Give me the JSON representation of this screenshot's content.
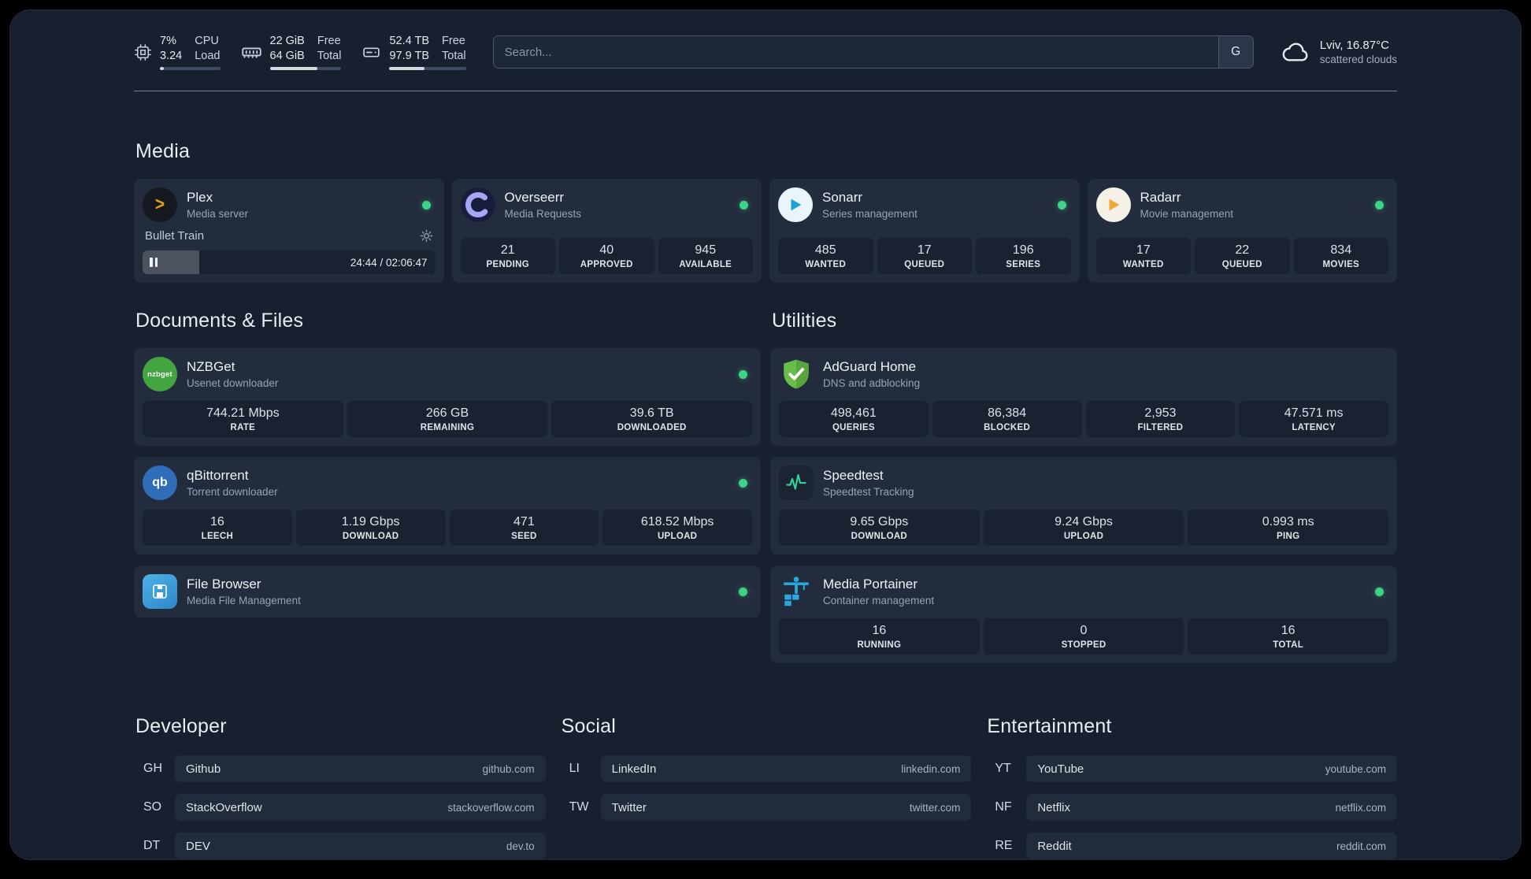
{
  "topbar": {
    "cpu": {
      "value1": "7%",
      "value2": "3.24",
      "label1": "CPU",
      "label2": "Load",
      "percent": 7
    },
    "memory": {
      "value1": "22 GiB",
      "value2": "64 GiB",
      "label1": "Free",
      "label2": "Total",
      "percent": 66
    },
    "disk": {
      "value1": "52.4 TB",
      "value2": "97.9 TB",
      "label1": "Free",
      "label2": "Total",
      "percent": 46
    },
    "search": {
      "placeholder": "Search...",
      "provider_button": "G"
    },
    "weather": {
      "location": "Lviv, 16.87°C",
      "condition": "scattered clouds"
    }
  },
  "media": {
    "title": "Media",
    "plex": {
      "name": "Plex",
      "subtitle": "Media server",
      "now_playing": "Bullet Train",
      "time": "24:44 / 02:06:47",
      "progress_percent": 19.5,
      "icon_glyph": ">"
    },
    "overseerr": {
      "name": "Overseerr",
      "subtitle": "Media Requests",
      "stats": [
        {
          "value": "21",
          "label": "PENDING"
        },
        {
          "value": "40",
          "label": "APPROVED"
        },
        {
          "value": "945",
          "label": "AVAILABLE"
        }
      ]
    },
    "sonarr": {
      "name": "Sonarr",
      "subtitle": "Series management",
      "stats": [
        {
          "value": "485",
          "label": "WANTED"
        },
        {
          "value": "17",
          "label": "QUEUED"
        },
        {
          "value": "196",
          "label": "SERIES"
        }
      ]
    },
    "radarr": {
      "name": "Radarr",
      "subtitle": "Movie management",
      "stats": [
        {
          "value": "17",
          "label": "WANTED"
        },
        {
          "value": "22",
          "label": "QUEUED"
        },
        {
          "value": "834",
          "label": "MOVIES"
        }
      ]
    }
  },
  "documents": {
    "title": "Documents & Files",
    "nzbget": {
      "name": "NZBGet",
      "subtitle": "Usenet downloader",
      "icon_label": "nzbget",
      "stats": [
        {
          "value": "744.21 Mbps",
          "label": "RATE"
        },
        {
          "value": "266 GB",
          "label": "REMAINING"
        },
        {
          "value": "39.6 TB",
          "label": "DOWNLOADED"
        }
      ]
    },
    "qbittorrent": {
      "name": "qBittorrent",
      "subtitle": "Torrent downloader",
      "icon_label": "qb",
      "stats": [
        {
          "value": "16",
          "label": "LEECH"
        },
        {
          "value": "1.19 Gbps",
          "label": "DOWNLOAD"
        },
        {
          "value": "471",
          "label": "SEED"
        },
        {
          "value": "618.52 Mbps",
          "label": "UPLOAD"
        }
      ]
    },
    "filebrowser": {
      "name": "File Browser",
      "subtitle": "Media File Management"
    }
  },
  "utilities": {
    "title": "Utilities",
    "adguard": {
      "name": "AdGuard Home",
      "subtitle": "DNS and adblocking",
      "stats": [
        {
          "value": "498,461",
          "label": "QUERIES"
        },
        {
          "value": "86,384",
          "label": "BLOCKED"
        },
        {
          "value": "2,953",
          "label": "FILTERED"
        },
        {
          "value": "47.571 ms",
          "label": "LATENCY"
        }
      ]
    },
    "speedtest": {
      "name": "Speedtest",
      "subtitle": "Speedtest Tracking",
      "stats": [
        {
          "value": "9.65 Gbps",
          "label": "DOWNLOAD"
        },
        {
          "value": "9.24 Gbps",
          "label": "UPLOAD"
        },
        {
          "value": "0.993 ms",
          "label": "PING"
        }
      ]
    },
    "portainer": {
      "name": "Media Portainer",
      "subtitle": "Container management",
      "stats": [
        {
          "value": "16",
          "label": "RUNNING"
        },
        {
          "value": "0",
          "label": "STOPPED"
        },
        {
          "value": "16",
          "label": "TOTAL"
        }
      ]
    }
  },
  "bookmarks": {
    "developer": {
      "title": "Developer",
      "items": [
        {
          "abbr": "GH",
          "name": "Github",
          "url": "github.com"
        },
        {
          "abbr": "SO",
          "name": "StackOverflow",
          "url": "stackoverflow.com"
        },
        {
          "abbr": "DT",
          "name": "DEV",
          "url": "dev.to"
        }
      ]
    },
    "social": {
      "title": "Social",
      "items": [
        {
          "abbr": "LI",
          "name": "LinkedIn",
          "url": "linkedin.com"
        },
        {
          "abbr": "TW",
          "name": "Twitter",
          "url": "twitter.com"
        }
      ]
    },
    "entertainment": {
      "title": "Entertainment",
      "items": [
        {
          "abbr": "YT",
          "name": "YouTube",
          "url": "youtube.com"
        },
        {
          "abbr": "NF",
          "name": "Netflix",
          "url": "netflix.com"
        },
        {
          "abbr": "RE",
          "name": "Reddit",
          "url": "reddit.com"
        }
      ]
    }
  },
  "colors": {
    "status_green": "#3ed488",
    "plex_amber": "#e5a00d",
    "sonarr_blue": "#1da0d8",
    "radarr_amber": "#f0a83a",
    "nzbget_green": "#42a53f",
    "qbittorrent_blue": "#2f6db8",
    "adguard_green": "#68bd49",
    "portainer_blue": "#29a8e0",
    "speedtest_green": "#34d399"
  }
}
